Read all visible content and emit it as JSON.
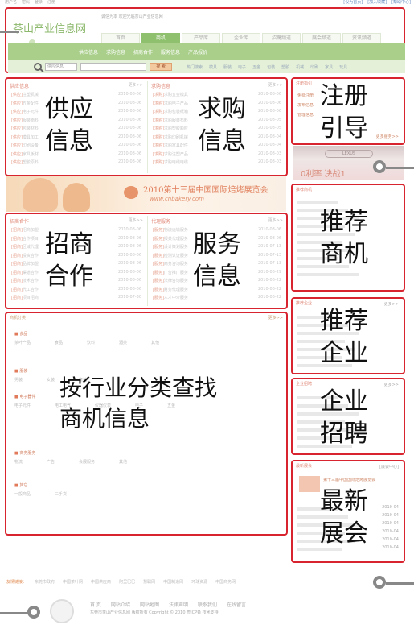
{
  "topbar": {
    "left": [
      "用户名",
      "密码",
      "登录",
      "注册"
    ],
    "right": [
      "[设为首页]",
      "[加入收藏]",
      "[帮助中心]"
    ]
  },
  "header": {
    "logo": "茶山产业信息网",
    "slogan": "诚信为本 欢迎光临茶山产业信息网",
    "tabs": [
      "首页",
      "商机",
      "产品库",
      "企业库",
      "招聘频道",
      "展会频道",
      "资讯频道"
    ],
    "active_tab_index": 1,
    "subnav": [
      "供应信息",
      "求购信息",
      "招商合作",
      "服务信息",
      "产品报价"
    ],
    "search_select": "供应信息",
    "search_button": "搜 索",
    "hotwords": [
      "热门搜索",
      "模具",
      "服装",
      "电子",
      "五金",
      "包装",
      "塑胶",
      "机械",
      "印刷",
      "家具",
      "玩具"
    ]
  },
  "sections": {
    "supply": {
      "head": "供应信息",
      "more": "更多>>",
      "annotation_line1": "供应",
      "annotation_line2": "信息",
      "rows": [
        {
          "tag": "[供应]",
          "title": "注塑机械",
          "date": "2010-08-06"
        },
        {
          "tag": "[供应]",
          "title": "五金配件",
          "date": "2010-08-06"
        },
        {
          "tag": "[供应]",
          "title": "电子元件",
          "date": "2010-08-06"
        },
        {
          "tag": "[供应]",
          "title": "服装面料",
          "date": "2010-08-06"
        },
        {
          "tag": "[供应]",
          "title": "包装材料",
          "date": "2010-08-06"
        },
        {
          "tag": "[供应]",
          "title": "模具加工",
          "date": "2010-08-06"
        },
        {
          "tag": "[供应]",
          "title": "印刷设备",
          "date": "2010-08-06"
        },
        {
          "tag": "[供应]",
          "title": "家具板材",
          "date": "2010-08-06"
        },
        {
          "tag": "[供应]",
          "title": "塑胶原料",
          "date": "2010-08-06"
        }
      ]
    },
    "demand": {
      "head": "求购信息",
      "more": "更多>>",
      "annotation_line1": "求购",
      "annotation_line2": "信息",
      "rows": [
        {
          "tag": "[求购]",
          "title": "求购五金模具",
          "date": "2010-08-06"
        },
        {
          "tag": "[求购]",
          "title": "求购电子产品",
          "date": "2010-08-06"
        },
        {
          "tag": "[求购]",
          "title": "求购包装纸箱",
          "date": "2010-08-06"
        },
        {
          "tag": "[求购]",
          "title": "求购服装布料",
          "date": "2010-08-05"
        },
        {
          "tag": "[求购]",
          "title": "求购塑胶颗粒",
          "date": "2010-08-05"
        },
        {
          "tag": "[求购]",
          "title": "求购印刷机械",
          "date": "2010-08-04"
        },
        {
          "tag": "[求购]",
          "title": "求购家具配件",
          "date": "2010-08-04"
        },
        {
          "tag": "[求购]",
          "title": "求购注塑产品",
          "date": "2010-08-03"
        },
        {
          "tag": "[求购]",
          "title": "求购电线电缆",
          "date": "2010-08-03"
        }
      ]
    },
    "banner": {
      "title": "2010第十三届中国国际焙烤展览会",
      "url": "www.cnbakery.com"
    },
    "invest": {
      "head": "招商合作",
      "more": "更多>>",
      "annotation_line1": "招商",
      "annotation_line2": "合作",
      "rows": [
        {
          "tag": "[招商]",
          "title": "招商加盟",
          "date": "2010-08-06"
        },
        {
          "tag": "[招商]",
          "title": "合作项目",
          "date": "2010-08-06"
        },
        {
          "tag": "[招商]",
          "title": "区域代理",
          "date": "2010-08-06"
        },
        {
          "tag": "[招商]",
          "title": "投资合作",
          "date": "2010-08-06"
        },
        {
          "tag": "[招商]",
          "title": "品牌加盟",
          "date": "2010-08-06"
        },
        {
          "tag": "[招商]",
          "title": "渠道合作",
          "date": "2010-08-06"
        },
        {
          "tag": "[招商]",
          "title": "技术合作",
          "date": "2010-08-06"
        },
        {
          "tag": "[招商]",
          "title": "代工合作",
          "date": "2010-08-06"
        },
        {
          "tag": "[招商]",
          "title": "项目招商",
          "date": "2010-07-30"
        }
      ]
    },
    "service": {
      "head": "代理服务",
      "more": "更多>>",
      "annotation_line1": "服务",
      "annotation_line2": "信息",
      "rows": [
        {
          "tag": "[服务]",
          "title": "物流运输服务",
          "date": "2010-08-06"
        },
        {
          "tag": "[服务]",
          "title": "报关代理服务",
          "date": "2010-08-06"
        },
        {
          "tag": "[服务]",
          "title": "设计策划服务",
          "date": "2010-07-13"
        },
        {
          "tag": "[服务]",
          "title": "检测认证服务",
          "date": "2010-07-13"
        },
        {
          "tag": "[服务]",
          "title": "商务咨询服务",
          "date": "2010-07-13"
        },
        {
          "tag": "[服务]",
          "title": "广告推广服务",
          "date": "2010-06-29"
        },
        {
          "tag": "[服务]",
          "title": "法律咨询服务",
          "date": "2010-06-22"
        },
        {
          "tag": "[服务]",
          "title": "财务代理服务",
          "date": "2010-06-22"
        },
        {
          "tag": "[服务]",
          "title": "人才中介服务",
          "date": "2010-06-22"
        }
      ]
    },
    "category": {
      "head": "商机分类",
      "more": "更多>>",
      "annotation_line1": "按行业分类查找",
      "annotation_line2": "商机信息",
      "groups": [
        {
          "name": "食品",
          "items": [
            "茶叶产品",
            "食品",
            "饮料",
            "酒类",
            "其他"
          ]
        },
        {
          "name": "服装",
          "items": [
            "男装",
            "女装",
            "童装"
          ]
        },
        {
          "name": "电子器件",
          "items": [
            "电子元件",
            "电工电气",
            "仪器仪表",
            "电子",
            "五金"
          ]
        },
        {
          "name": "商务服务",
          "items": [
            "物流",
            "广告",
            "会展服务",
            "其他"
          ]
        },
        {
          "name": "其它",
          "items": [
            "一般商品",
            "二手货"
          ]
        }
      ]
    }
  },
  "right": {
    "register": {
      "head": "注册指引",
      "annotation_line1": "注册",
      "annotation_line2": "引导",
      "items": [
        "免费注册",
        "发布信息",
        "管理信息"
      ],
      "more": "更多服务>>"
    },
    "ad": {
      "brand": "LEXUS",
      "text": "0利率 决战1"
    },
    "recommend_biz": {
      "head": "推荐商机",
      "annotation_line1": "推荐",
      "annotation_line2": "商机"
    },
    "recommend_co": {
      "head": "推荐企业",
      "more": "更多>>",
      "annotation_line1": "推荐",
      "annotation_line2": "企业"
    },
    "recruit": {
      "head": "企业招聘",
      "more": "更多>>",
      "annotation_line1": "企业",
      "annotation_line2": "招聘"
    },
    "expo": {
      "head": "最新展会",
      "more": "[展会中心]",
      "annotation_line1": "最新",
      "annotation_line2": "展会",
      "feature": "第十三届中国国际焙烤展览会",
      "dates": [
        "2010-04",
        "2010-04",
        "2010-04",
        "2010-04",
        "2010-04",
        "2010-04"
      ]
    }
  },
  "footer": {
    "links_label": "友情链接：",
    "links": [
      "东莞市政府",
      "中国茶叶网",
      "中国供应商",
      "阿里巴巴",
      "慧聪网",
      "中国制造网",
      "环球资源",
      "中国商务网"
    ],
    "nav": [
      "首 页",
      "网站介绍",
      "网站地图",
      "法律声明",
      "联系我们",
      "在线留言"
    ],
    "copyright": "东莞市茶山产业信息网 版权所有 Copyright © 2010 粤ICP备 技术支持",
    "colors": {
      "accent": "#8fc06d",
      "frame": "#d8242f"
    }
  }
}
